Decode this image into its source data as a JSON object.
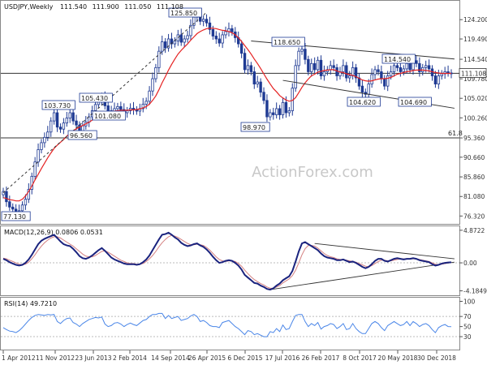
{
  "chart_data": [
    {
      "type": "candlestick",
      "title": "USDJPY,Weekly",
      "ohlc": {
        "open": "111.540",
        "high": "111.900",
        "low": "111.050",
        "close": "111.108"
      },
      "y_ticks": [
        "124.200",
        "119.490",
        "114.540",
        "109.780",
        "105.020",
        "100.260",
        "95.360",
        "90.660",
        "85.860",
        "81.080",
        "76.320"
      ],
      "ylim": [
        74.8,
        128.2
      ],
      "price_label": "111.108",
      "fib_label": "61.8",
      "fib_level": 95.36,
      "callouts": [
        {
          "text": "77.130",
          "value": 77.13
        },
        {
          "text": "103.730",
          "value": 103.73
        },
        {
          "text": "96.560",
          "value": 96.56
        },
        {
          "text": "105.430",
          "value": 105.43
        },
        {
          "text": "101.080",
          "value": 101.08
        },
        {
          "text": "125.850",
          "value": 125.85
        },
        {
          "text": "98.970",
          "value": 98.97
        },
        {
          "text": "118.650",
          "value": 118.65
        },
        {
          "text": "104.620",
          "value": 104.62
        },
        {
          "text": "114.540",
          "value": 114.54
        },
        {
          "text": "104.690",
          "value": 104.69
        }
      ],
      "close_series": [
        82.3,
        79.8,
        78.5,
        78.0,
        77.5,
        77.6,
        79.0,
        80.4,
        82.8,
        86.0,
        89.5,
        92.5,
        94.2,
        95.5,
        96.8,
        99.5,
        101.5,
        98.0,
        97.5,
        99.0,
        100.2,
        101.5,
        99.5,
        98.5,
        97.0,
        98.3,
        99.2,
        100.5,
        102.0,
        103.5,
        104.5,
        105.2,
        103.2,
        102.0,
        101.8,
        102.5,
        103.0,
        102.3,
        101.5,
        102.0,
        102.6,
        102.2,
        101.9,
        102.5,
        103.6,
        104.3,
        106.8,
        109.8,
        112.5,
        116.5,
        118.8,
        117.3,
        119.5,
        118.3,
        119.0,
        120.5,
        118.7,
        119.5,
        120.3,
        122.8,
        124.8,
        125.5,
        123.8,
        124.3,
        123.4,
        121.8,
        120.2,
        119.5,
        118.5,
        120.5,
        121.3,
        122.0,
        121.2,
        119.8,
        118.3,
        116.0,
        112.0,
        113.0,
        111.5,
        108.5,
        109.0,
        106.5,
        104.5,
        100.5,
        101.5,
        101.0,
        102.5,
        101.0,
        104.0,
        101.5,
        102.0,
        107.5,
        113.0,
        116.5,
        117.0,
        114.5,
        111.5,
        113.5,
        112.0,
        114.3,
        110.5,
        111.5,
        112.0,
        113.0,
        112.5,
        110.5,
        111.5,
        113.0,
        110.0,
        110.5,
        112.5,
        110.0,
        108.0,
        106.5,
        106.0,
        108.5,
        110.8,
        112.0,
        111.5,
        109.8,
        108.0,
        110.5,
        111.5,
        113.0,
        112.5,
        111.5,
        112.2,
        113.5,
        112.0,
        114.2,
        113.5,
        111.5,
        112.5,
        113.0,
        112.2,
        110.5,
        108.5,
        110.5,
        111.0,
        111.5,
        111.2,
        111.1
      ],
      "ma_series": [
        80.8,
        80.6,
        80.3,
        80.2,
        80.0,
        80.0,
        80.4,
        81.2,
        82.3,
        83.6,
        85.1,
        86.5,
        87.9,
        89.2,
        90.5,
        91.7,
        92.8,
        93.6,
        94.3,
        95.0,
        95.8,
        96.5,
        97.1,
        97.6,
        98.0,
        98.4,
        98.8,
        99.2,
        99.7,
        100.2,
        100.7,
        101.2,
        101.5,
        101.7,
        101.8,
        101.9,
        102.0,
        102.1,
        102.1,
        102.1,
        102.2,
        102.2,
        102.3,
        102.4,
        102.7,
        103.0,
        103.6,
        104.5,
        105.6,
        107.1,
        108.8,
        110.3,
        111.9,
        113.3,
        114.6,
        115.8,
        116.7,
        117.5,
        118.3,
        119.2,
        120.0,
        120.8,
        121.3,
        121.7,
        122.0,
        122.1,
        122.1,
        122.0,
        121.8,
        121.6,
        121.5,
        121.3,
        121.0,
        120.5,
        119.8,
        118.9,
        117.9,
        116.9,
        115.8,
        114.6,
        113.5,
        112.3,
        111.0,
        109.7,
        108.5,
        107.4,
        106.6,
        105.7,
        105.1,
        104.6,
        104.3,
        104.5,
        105.2,
        106.4,
        107.7,
        108.8,
        109.7,
        110.5,
        110.9,
        111.4,
        111.6,
        111.8,
        111.9,
        112.0,
        112.0,
        111.7,
        111.4,
        111.3,
        111.0,
        110.8,
        110.6,
        110.3,
        109.9,
        109.5,
        109.3,
        109.2,
        109.3,
        109.5,
        109.7,
        109.8,
        109.8,
        109.9,
        110.1,
        110.5,
        110.9,
        111.1,
        111.3,
        111.5,
        111.6,
        111.8,
        111.9,
        111.9,
        111.9,
        111.8,
        111.7,
        111.5,
        111.3,
        111.2,
        111.1,
        111.1,
        111.1,
        111.1
      ],
      "trendline_dashed": [
        [
          0,
          82.0
        ],
        [
          64,
          126.0
        ]
      ],
      "channel_upper": [
        [
          78,
          119.0
        ],
        [
          142,
          114.6
        ]
      ],
      "channel_lower": [
        [
          88,
          109.4
        ],
        [
          142,
          102.6
        ]
      ]
    },
    {
      "type": "line",
      "title": "MACD(12,26,9) 0.0806 0.0531",
      "y_ticks": [
        "4.8722",
        "0.00",
        "-4.1849"
      ],
      "ylim": [
        -4.6,
        5.1
      ],
      "zero_label": "0.00",
      "macd_series": [
        0.6,
        0.4,
        0.1,
        -0.1,
        -0.3,
        -0.4,
        -0.3,
        0.0,
        0.5,
        1.2,
        2.0,
        2.8,
        3.3,
        3.6,
        3.8,
        4.0,
        4.2,
        3.7,
        3.2,
        2.8,
        2.6,
        2.5,
        2.1,
        1.6,
        1.0,
        0.7,
        0.6,
        0.8,
        1.1,
        1.5,
        1.9,
        2.2,
        1.8,
        1.3,
        0.8,
        0.5,
        0.3,
        0.1,
        -0.1,
        -0.2,
        -0.2,
        -0.2,
        -0.3,
        -0.2,
        0.1,
        0.5,
        1.1,
        1.9,
        2.7,
        3.5,
        4.2,
        4.3,
        4.5,
        4.2,
        3.8,
        3.5,
        3.0,
        2.7,
        2.5,
        2.6,
        2.8,
        2.9,
        2.6,
        2.4,
        2.0,
        1.5,
        0.9,
        0.4,
        0.0,
        0.1,
        0.3,
        0.4,
        0.3,
        0.0,
        -0.4,
        -1.0,
        -1.8,
        -2.2,
        -2.6,
        -3.0,
        -3.1,
        -3.4,
        -3.6,
        -3.9,
        -4.0,
        -3.8,
        -3.4,
        -3.1,
        -2.6,
        -2.3,
        -2.0,
        -1.2,
        0.2,
        1.7,
        2.9,
        3.1,
        2.8,
        2.5,
        2.2,
        1.9,
        1.4,
        1.0,
        0.8,
        0.7,
        0.6,
        0.4,
        0.4,
        0.5,
        0.3,
        0.1,
        0.2,
        0.0,
        -0.3,
        -0.6,
        -0.8,
        -0.6,
        -0.2,
        0.3,
        0.6,
        0.6,
        0.3,
        0.2,
        0.4,
        0.6,
        0.7,
        0.6,
        0.5,
        0.6,
        0.6,
        0.7,
        0.6,
        0.4,
        0.3,
        0.2,
        0.1,
        -0.2,
        -0.4,
        -0.3,
        -0.1,
        0.0,
        0.05,
        0.08
      ],
      "signal_series": [
        0.7,
        0.6,
        0.4,
        0.2,
        0.0,
        -0.2,
        -0.3,
        -0.2,
        0.1,
        0.6,
        1.2,
        1.9,
        2.5,
        3.0,
        3.4,
        3.7,
        3.9,
        3.9,
        3.7,
        3.4,
        3.1,
        2.8,
        2.5,
        2.1,
        1.7,
        1.3,
        1.0,
        0.9,
        0.9,
        1.1,
        1.4,
        1.7,
        1.8,
        1.6,
        1.3,
        1.0,
        0.7,
        0.4,
        0.2,
        0.0,
        -0.1,
        -0.1,
        -0.2,
        -0.2,
        -0.1,
        0.2,
        0.6,
        1.1,
        1.7,
        2.4,
        3.0,
        3.5,
        3.9,
        4.1,
        4.0,
        3.8,
        3.5,
        3.2,
        2.9,
        2.7,
        2.7,
        2.8,
        2.7,
        2.6,
        2.3,
        1.9,
        1.4,
        0.9,
        0.5,
        0.3,
        0.2,
        0.3,
        0.3,
        0.2,
        -0.1,
        -0.5,
        -1.1,
        -1.6,
        -2.1,
        -2.5,
        -2.8,
        -3.1,
        -3.3,
        -3.6,
        -3.8,
        -3.8,
        -3.6,
        -3.4,
        -3.0,
        -2.7,
        -2.4,
        -1.9,
        -1.1,
        0.0,
        1.2,
        2.1,
        2.6,
        2.6,
        2.5,
        2.2,
        1.8,
        1.4,
        1.1,
        0.9,
        0.8,
        0.6,
        0.5,
        0.5,
        0.4,
        0.3,
        0.2,
        0.1,
        -0.1,
        -0.3,
        -0.5,
        -0.6,
        -0.4,
        -0.1,
        0.2,
        0.4,
        0.4,
        0.3,
        0.3,
        0.4,
        0.5,
        0.6,
        0.6,
        0.6,
        0.6,
        0.6,
        0.6,
        0.5,
        0.4,
        0.3,
        0.2,
        0.0,
        -0.2,
        -0.3,
        -0.2,
        -0.1,
        0.0,
        0.05
      ]
    },
    {
      "type": "line",
      "title": "RSI(14) 49.7210",
      "y_ticks": [
        "100",
        "70",
        "50",
        "30"
      ],
      "ylim": [
        6,
        104
      ],
      "levels": [
        70,
        30
      ],
      "rsi_series": [
        48,
        44,
        41,
        40,
        38,
        42,
        48,
        55,
        62,
        68,
        72,
        74,
        73,
        72,
        74,
        73,
        74,
        60,
        56,
        62,
        66,
        67,
        58,
        55,
        50,
        56,
        60,
        64,
        66,
        68,
        67,
        69,
        55,
        50,
        52,
        57,
        58,
        55,
        50,
        54,
        57,
        54,
        52,
        57,
        62,
        64,
        70,
        74,
        74,
        76,
        76,
        66,
        72,
        66,
        68,
        70,
        62,
        64,
        66,
        71,
        74,
        70,
        60,
        62,
        58,
        52,
        50,
        50,
        48,
        58,
        60,
        62,
        56,
        50,
        46,
        40,
        34,
        42,
        40,
        34,
        36,
        33,
        30,
        30,
        40,
        38,
        46,
        40,
        53,
        44,
        46,
        60,
        72,
        74,
        74,
        60,
        50,
        56,
        52,
        58,
        45,
        50,
        52,
        56,
        54,
        46,
        50,
        56,
        44,
        46,
        56,
        46,
        40,
        36,
        36,
        46,
        56,
        60,
        56,
        48,
        42,
        52,
        56,
        60,
        56,
        52,
        54,
        60,
        52,
        60,
        56,
        50,
        54,
        56,
        52,
        44,
        38,
        48,
        52,
        54,
        50,
        49.7
      ]
    }
  ],
  "x_ticks": [
    "1 Apr 2012",
    "11 Nov 2012",
    "23 Jun 2013",
    "2 Feb 2014",
    "14 Sep 2014",
    "26 Apr 2015",
    "6 Dec 2015",
    "17 Jul 2016",
    "26 Feb 2017",
    "8 Oct 2017",
    "20 May 2018",
    "30 Dec 2018"
  ],
  "watermark": "ActionForex.com",
  "colors": {
    "candle": "#1f3a93",
    "ma": "#e52222",
    "macd": "#1a237e",
    "signal": "#d48080",
    "rsi": "#4a86e8",
    "grid": "#bbbbbb",
    "trend": "#333333"
  }
}
